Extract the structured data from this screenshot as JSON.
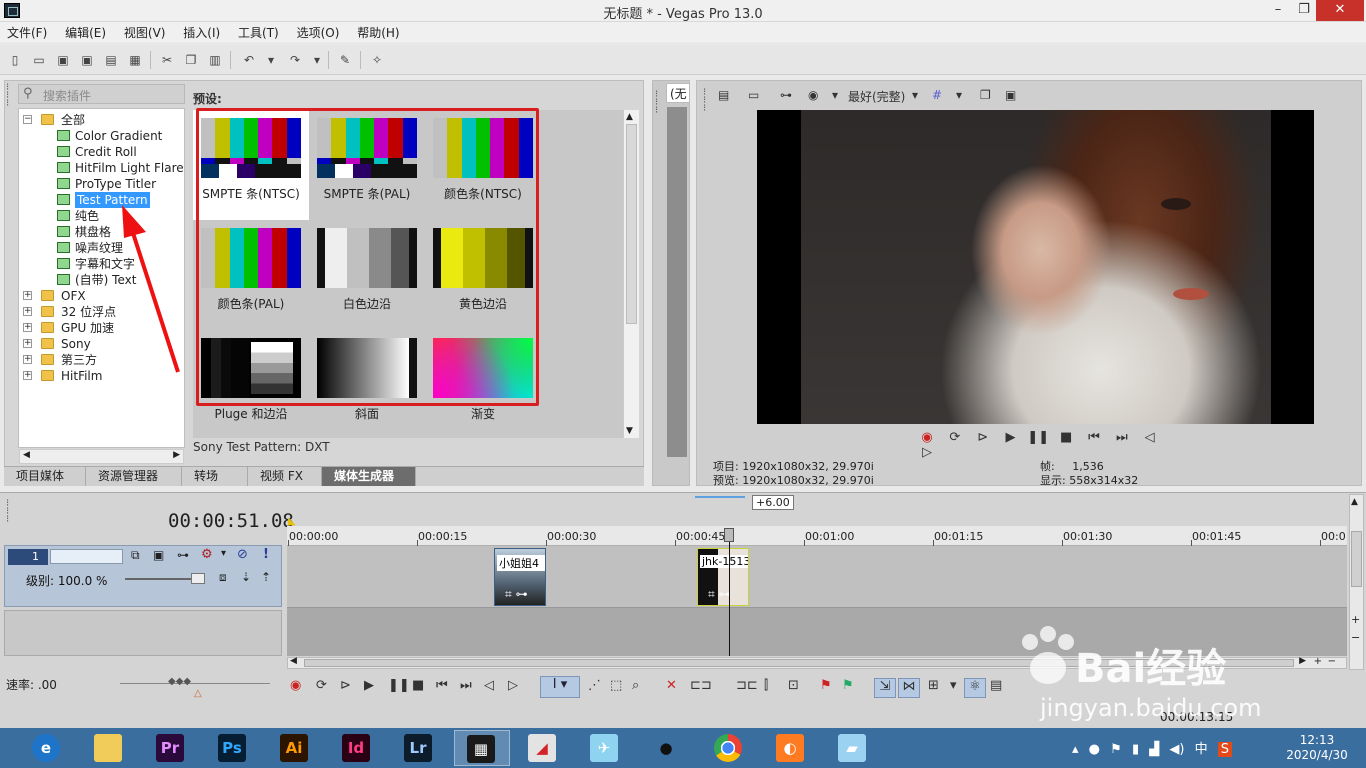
{
  "window": {
    "title": "无标题 * - Vegas Pro 13.0",
    "minimize": "–",
    "maximize": "❐",
    "close": "✕"
  },
  "menu": [
    "文件(F)",
    "编辑(E)",
    "视图(V)",
    "插入(I)",
    "工具(T)",
    "选项(O)",
    "帮助(H)"
  ],
  "toolbar_icons": [
    "new-icon",
    "open-icon",
    "save-icon",
    "save-as-icon",
    "render-icon",
    "properties-icon",
    "cut-icon",
    "copy-icon",
    "paste-icon",
    "undo-icon",
    "redo-icon",
    "cursor-icon",
    "selection-tool-icon"
  ],
  "plugins": {
    "search_placeholder": "搜索插件",
    "tree": [
      {
        "label": "全部",
        "type": "folder",
        "expanded": true
      },
      {
        "label": "Color Gradient",
        "type": "plugin"
      },
      {
        "label": "Credit Roll",
        "type": "plugin"
      },
      {
        "label": "HitFilm Light Flares",
        "type": "plugin"
      },
      {
        "label": "ProType Titler",
        "type": "plugin"
      },
      {
        "label": "Test Pattern",
        "type": "plugin",
        "selected": true
      },
      {
        "label": "纯色",
        "type": "plugin"
      },
      {
        "label": "棋盘格",
        "type": "plugin"
      },
      {
        "label": "噪声纹理",
        "type": "plugin"
      },
      {
        "label": "字幕和文字",
        "type": "plugin"
      },
      {
        "label": "(自带) Text",
        "type": "plugin"
      },
      {
        "label": "OFX",
        "type": "folder"
      },
      {
        "label": "32 位浮点",
        "type": "folder"
      },
      {
        "label": "GPU 加速",
        "type": "folder"
      },
      {
        "label": "Sony",
        "type": "folder"
      },
      {
        "label": "第三方",
        "type": "folder"
      },
      {
        "label": "HitFilm",
        "type": "folder"
      }
    ]
  },
  "presets": {
    "label": "预设:",
    "items": [
      {
        "label": "SMPTE 条(NTSC)",
        "pattern": "smpte",
        "selected": true
      },
      {
        "label": "SMPTE 条(PAL)",
        "pattern": "smpte"
      },
      {
        "label": "颜色条(NTSC)",
        "pattern": "bars"
      },
      {
        "label": "颜色条(PAL)",
        "pattern": "bars"
      },
      {
        "label": "白色边沿",
        "pattern": "white-edge"
      },
      {
        "label": "黄色边沿",
        "pattern": "yellow-edge"
      },
      {
        "label": "Pluge 和边沿",
        "pattern": "pluge"
      },
      {
        "label": "斜面",
        "pattern": "ramp"
      },
      {
        "label": "渐变",
        "pattern": "gradient"
      }
    ],
    "status": "Sony Test Pattern: DXT"
  },
  "left_tabs": [
    {
      "label": "项目媒体",
      "active": false
    },
    {
      "label": "资源管理器",
      "active": false
    },
    {
      "label": "转场",
      "active": false
    },
    {
      "label": "视频 FX",
      "active": false
    },
    {
      "label": "媒体生成器",
      "active": true
    }
  ],
  "trimmer": {
    "tab_label": "(无"
  },
  "preview": {
    "quality": "最好(完整)",
    "info": {
      "project": "项目: 1920x1080x32, 29.970i",
      "preview": "预览: 1920x1080x32, 29.970i",
      "frame_label": "帧:",
      "frame_value": "1,536",
      "display_label": "显示:",
      "display_value": "558x314x32"
    }
  },
  "timeline": {
    "timecode": "00:00:51.08",
    "track_number": "1",
    "level": "级别: 100.0 %",
    "rate": "速率: .00",
    "marker_label": "+6.00",
    "ruler": [
      "00:00:00",
      "00:00:15",
      "00:00:30",
      "00:00:45",
      "00:01:00",
      "00:01:15",
      "00:01:30",
      "00:01:45",
      "00:0"
    ],
    "clips": [
      {
        "label": "小姐姐4"
      },
      {
        "label": "jhk-1513"
      }
    ],
    "status": "00:00:13:15"
  },
  "watermark": {
    "text": "Bai经验",
    "url": "jingyan.baidu.com"
  },
  "taskbar": {
    "apps": [
      {
        "name": "ie-icon",
        "text": "e",
        "bg": "#1e74c8",
        "fg": "#ffffff"
      },
      {
        "name": "file-explorer-icon",
        "text": "",
        "bg": "#f2cc5a",
        "fg": "#ffffff"
      },
      {
        "name": "premiere-icon",
        "text": "Pr",
        "bg": "#2a0a3a",
        "fg": "#e18bff"
      },
      {
        "name": "photoshop-icon",
        "text": "Ps",
        "bg": "#061e33",
        "fg": "#31a8ff"
      },
      {
        "name": "illustrator-icon",
        "text": "Ai",
        "bg": "#2b1400",
        "fg": "#ff9a00"
      },
      {
        "name": "indesign-icon",
        "text": "Id",
        "bg": "#2a0014",
        "fg": "#ff3d83"
      },
      {
        "name": "lightroom-icon",
        "text": "Lr",
        "bg": "#0c1c2a",
        "fg": "#9ec9ff"
      },
      {
        "name": "vegas-icon",
        "text": "▦",
        "bg": "#1a1a1a",
        "fg": "#ffffff"
      },
      {
        "name": "app-parrot-icon",
        "text": "◢",
        "bg": "#e3e3e3",
        "fg": "#d2232a"
      },
      {
        "name": "app-bird-icon",
        "text": "✈",
        "bg": "#8ed3f0",
        "fg": "#ffffff"
      },
      {
        "name": "qq-icon",
        "text": "●",
        "bg": "#3a6e9f",
        "fg": "#111111"
      },
      {
        "name": "chrome-icon",
        "text": "◉",
        "bg": "#3a6e9f",
        "fg": "#e4432f"
      },
      {
        "name": "app-orange-icon",
        "text": "◐",
        "bg": "#ff7b21",
        "fg": "#ffffff"
      },
      {
        "name": "app-blue-icon",
        "text": "▰",
        "bg": "#9bd2f2",
        "fg": "#ffffff"
      }
    ],
    "time": "12:13",
    "date": "2020/4/30",
    "tray_ime": "中"
  }
}
